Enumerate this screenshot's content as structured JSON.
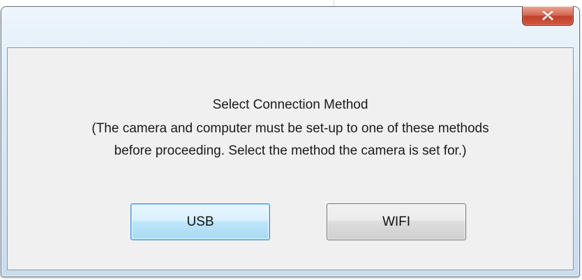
{
  "dialog": {
    "close_icon": "close-icon",
    "close_button_color": "#c7432d",
    "message": {
      "line1": "Select Connection Method",
      "line2": "(The camera and computer must be set-up to one of these methods",
      "line3": "before proceeding.  Select the method the camera is set for.)"
    },
    "buttons": {
      "usb_label": "USB",
      "wifi_label": "WIFI"
    },
    "focused_button": "USB",
    "focus_color": "#3c8fd6"
  }
}
